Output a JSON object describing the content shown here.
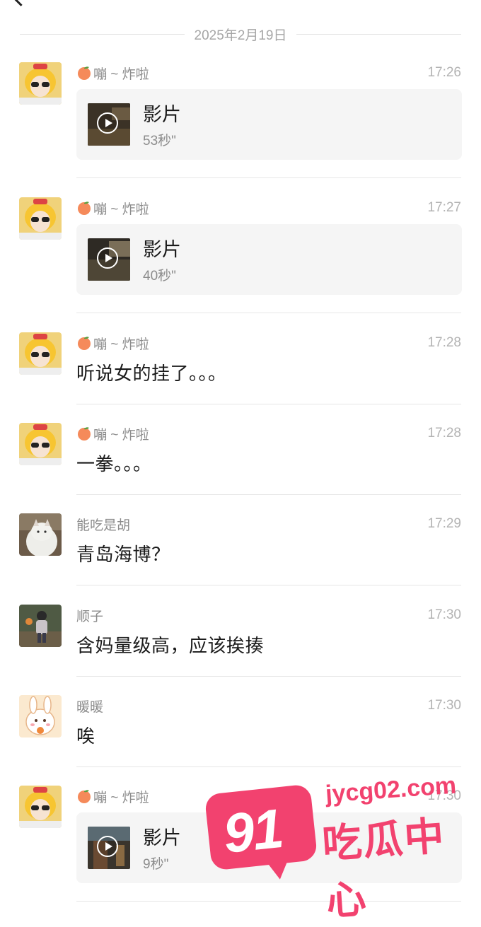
{
  "header": {
    "back_icon": "back-arrow-icon"
  },
  "date_separator": "2025年2月19日",
  "messages": [
    {
      "name": "嘣 ~ 炸啦",
      "time": "17:26",
      "type": "video",
      "video_title": "影片",
      "video_duration": "53秒\""
    },
    {
      "name": "嘣 ~ 炸啦",
      "time": "17:27",
      "type": "video",
      "video_title": "影片",
      "video_duration": "40秒\""
    },
    {
      "name": "嘣 ~ 炸啦",
      "time": "17:28",
      "type": "text",
      "text": "听说女的挂了。。。"
    },
    {
      "name": "嘣 ~ 炸啦",
      "time": "17:28",
      "type": "text",
      "text": "一拳。。。"
    },
    {
      "name": "能吃是胡",
      "time": "17:29",
      "type": "text",
      "text": "青岛海博？"
    },
    {
      "name": "顺子",
      "time": "17:30",
      "type": "text",
      "text": "含妈量级高，应该挨揍"
    },
    {
      "name": "暖暖",
      "time": "17:30",
      "type": "text",
      "text": "唉"
    },
    {
      "name": "嘣 ~ 炸啦",
      "time": "17:30",
      "type": "video",
      "video_title": "影片",
      "video_duration": "9秒\""
    }
  ],
  "watermark": {
    "number": "91",
    "url": "jycg02.com",
    "name": "吃瓜中心"
  },
  "colors": {
    "background": "#ffffff",
    "card": "#f5f5f5",
    "watermark": "#f2426f",
    "muted": "#8c8c8c"
  }
}
